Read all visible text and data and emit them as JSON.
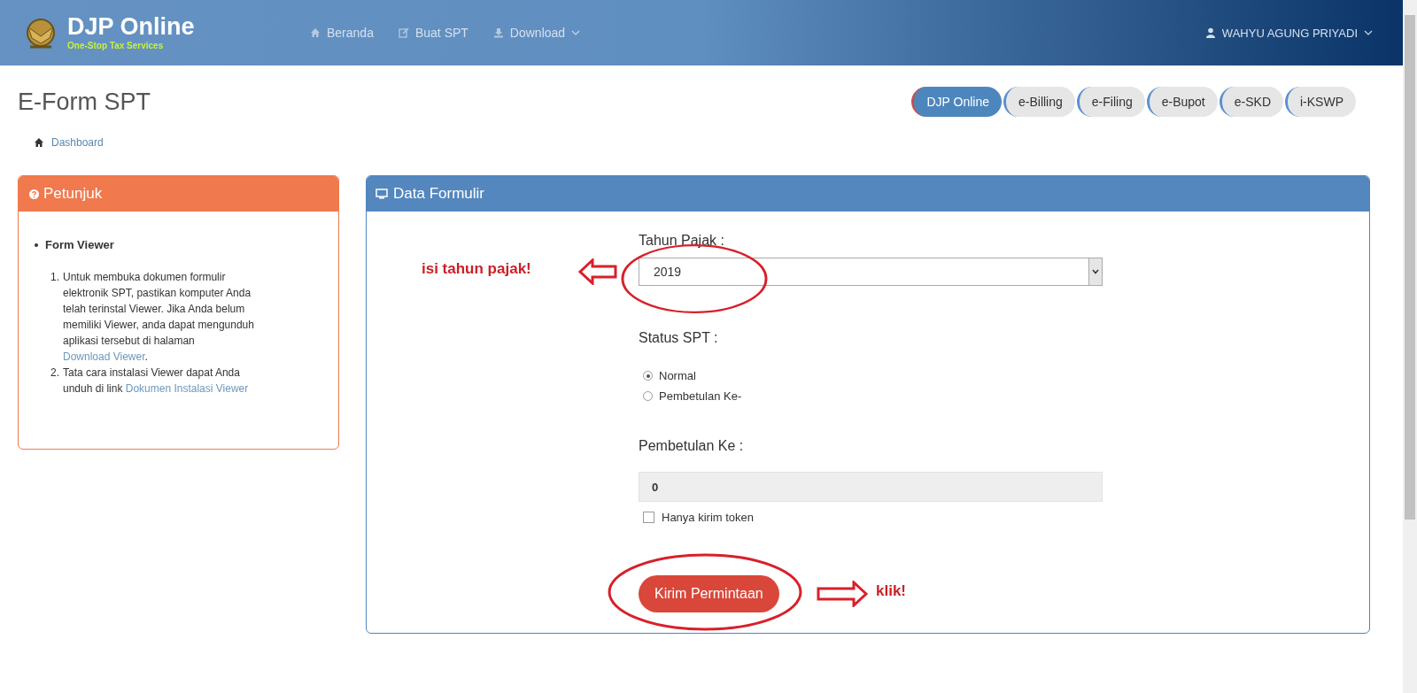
{
  "header": {
    "logo_title": "DJP Online",
    "logo_subtitle": "One-Stop Tax Services",
    "nav": [
      {
        "label": "Beranda",
        "dropdown": false
      },
      {
        "label": "Buat SPT",
        "dropdown": false
      },
      {
        "label": "Download",
        "dropdown": true
      }
    ],
    "user": "WAHYU AGUNG PRIYADI"
  },
  "page_title": "E-Form SPT",
  "apps": [
    {
      "label": "DJP Online",
      "selected": true
    },
    {
      "label": "e-Billing",
      "selected": false
    },
    {
      "label": "e-Filing",
      "selected": false
    },
    {
      "label": "e-Bupot",
      "selected": false
    },
    {
      "label": "e-SKD",
      "selected": false
    },
    {
      "label": "i-KSWP",
      "selected": false
    }
  ],
  "breadcrumb": "Dashboard",
  "guide": {
    "title": "Petunjuk",
    "heading": "Form Viewer",
    "steps": [
      {
        "number": "1.",
        "text": "Untuk membuka dokumen formulir elektronik SPT, pastikan komputer Anda telah terinstal Viewer. Jika Anda belum memiliki Viewer, anda dapat mengunduh aplikasi tersebut di halaman ",
        "link": "Download Viewer",
        "after": "."
      },
      {
        "number": "2.",
        "text": "Tata cara instalasi Viewer dapat Anda unduh di link ",
        "link": "Dokumen Instalasi Viewer"
      }
    ]
  },
  "form": {
    "title": "Data Formulir",
    "year_label": "Tahun Pajak :",
    "year_value": "2019",
    "status_label": "Status SPT :",
    "status_options": [
      {
        "label": "Normal",
        "selected": true
      },
      {
        "label": "Pembetulan Ke-",
        "selected": false
      }
    ],
    "revision_label": "Pembetulan Ke :",
    "revision_value": "0",
    "token_label": "Hanya kirim token",
    "token_checked": false,
    "submit": "Kirim Permintaan",
    "year_annotation": "isi tahun pajak!",
    "submit_annotation": "klik!"
  }
}
